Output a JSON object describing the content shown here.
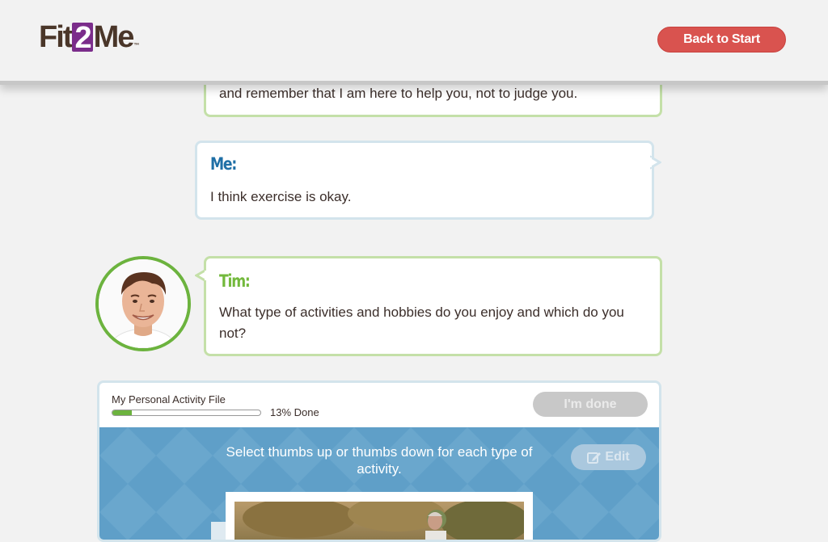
{
  "header": {
    "logo": {
      "part1": "Fit",
      "part2": "2",
      "part3": "Me",
      "tm": "™"
    },
    "back_button": "Back to Start"
  },
  "conversation": {
    "tim_name": "Tim:",
    "me_name": "Me:",
    "messages": [
      {
        "speaker": "tim",
        "text": "and remember that I am here to help you, not to judge you."
      },
      {
        "speaker": "me",
        "text": "I think exercise is okay."
      },
      {
        "speaker": "tim",
        "text": "What type of activities and hobbies do you enjoy and which do you not?"
      }
    ]
  },
  "activity_panel": {
    "title": "My Personal Activity File",
    "progress_percent": 13,
    "progress_label": "13% Done",
    "done_button": "I'm done",
    "instruction": "Select thumbs up or thumbs down for each type of activity.",
    "edit_button": "Edit",
    "edit_icon": "pencil-square-icon"
  },
  "colors": {
    "brand_brown": "#4a3629",
    "brand_purple": "#7b2d8b",
    "accent_red": "#d9534f",
    "tim_green": "#73b93c",
    "me_blue": "#1f6fa6",
    "panel_blue": "#5f9fc8"
  }
}
